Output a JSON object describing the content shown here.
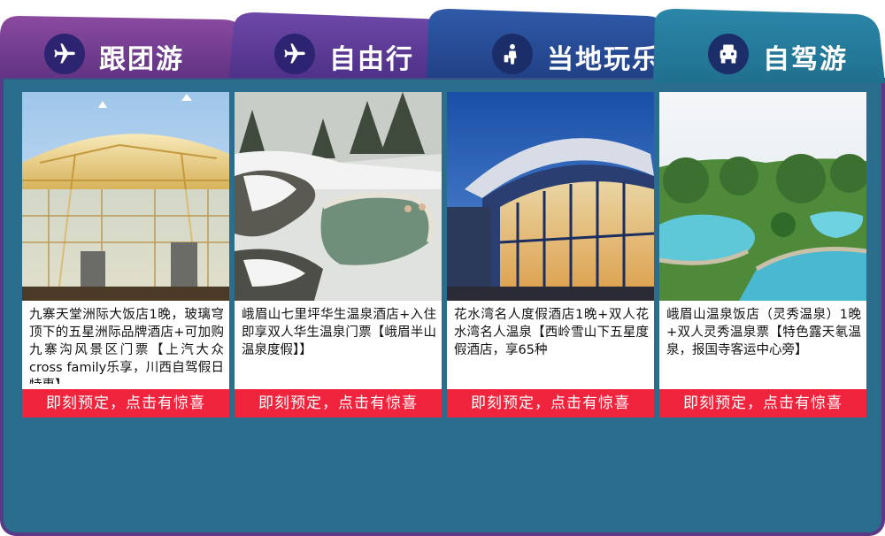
{
  "tabs": [
    {
      "label": "跟团游",
      "icon": "airplane-icon"
    },
    {
      "label": "自由行",
      "icon": "airplane-icon"
    },
    {
      "label": "当地玩乐",
      "icon": "traveler-icon"
    },
    {
      "label": "自驾游",
      "icon": "car-icon"
    }
  ],
  "cards": [
    {
      "description": "九寨天堂洲际大饭店1晚，玻璃穹顶下的五星洲际品牌酒店+可加购九寨沟风景区门票【上汽大众cross family乐享，川西自驾假日特惠】",
      "cta": "即刻预定，点击有惊喜"
    },
    {
      "description": "峨眉山七里坪华生温泉酒店+入住即享双人华生温泉门票【峨眉半山温泉度假】】",
      "cta": "即刻预定，点击有惊喜"
    },
    {
      "description": "花水湾名人度假酒店1晚+双人花水湾名人温泉【西岭雪山下五星度假酒店，享65种",
      "cta": "即刻预定，点击有惊喜"
    },
    {
      "description": "峨眉山温泉饭店（灵秀温泉）1晚+双人灵秀温泉票【特色露天氡温泉，报国寺客运中心旁】",
      "cta": "即刻预定，点击有惊喜"
    }
  ],
  "colors": {
    "tab1": "#6b3a8a",
    "tab2": "#5a3790",
    "tab3": "#284d94",
    "tab4": "#1f6f90",
    "panel": "#2a6d8c",
    "cta": "#f0243c",
    "icon_circle": "#2a2a6e"
  }
}
